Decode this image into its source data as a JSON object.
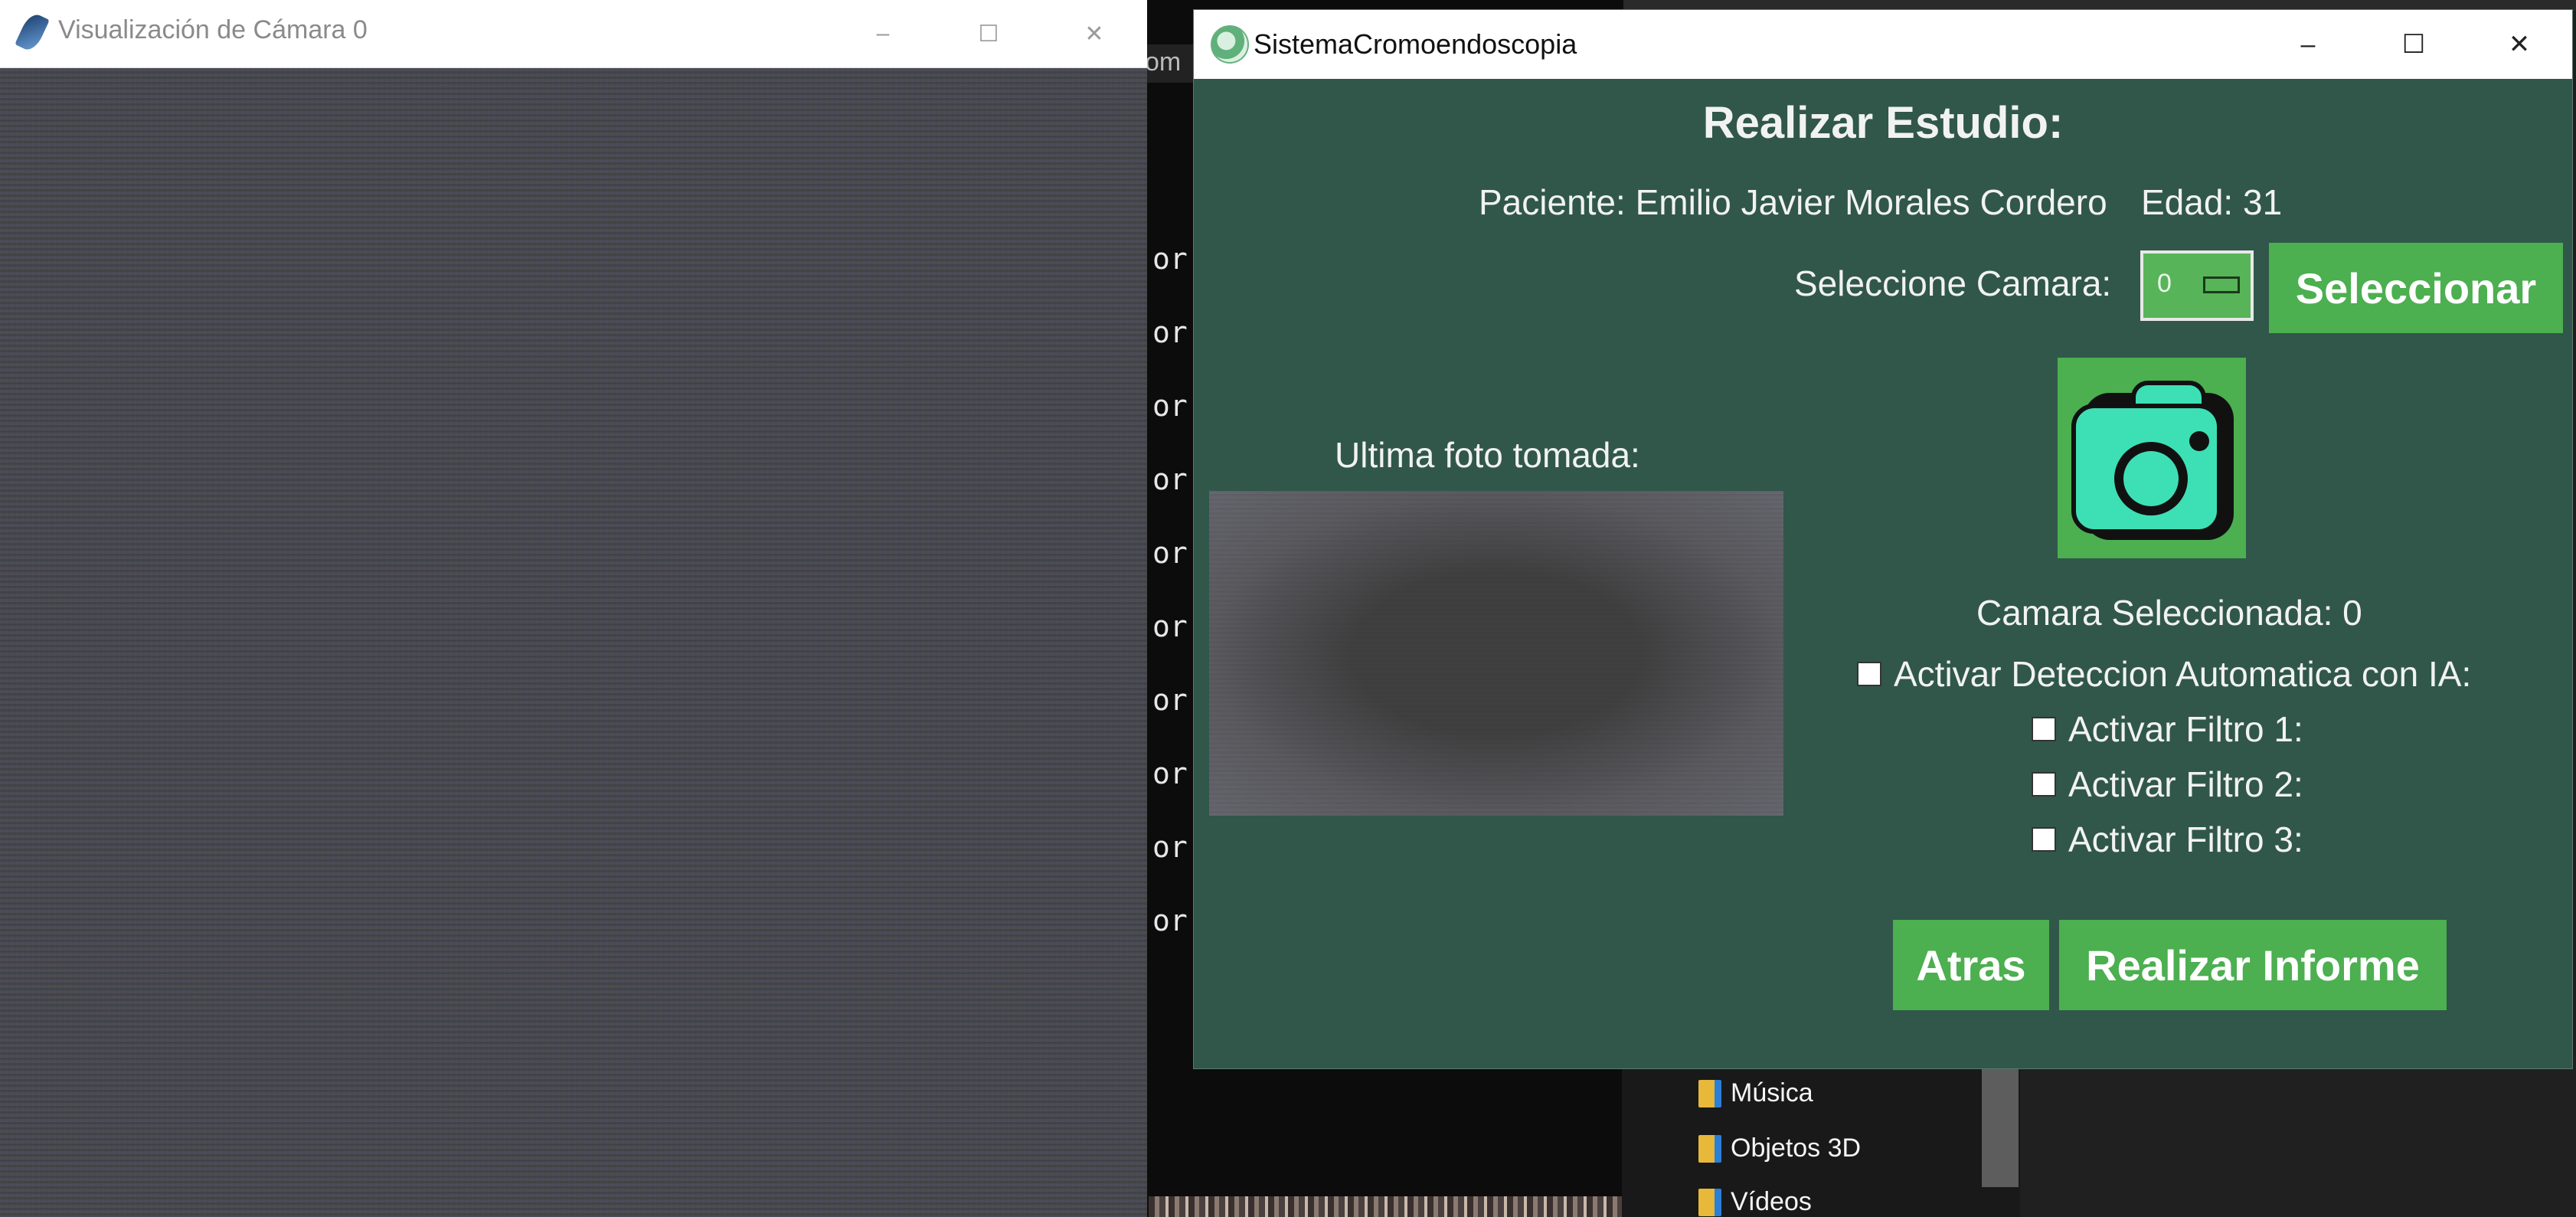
{
  "camera_window": {
    "title": "Visualización de Cámara 0",
    "controls": {
      "minimize": "–",
      "maximize": "☐",
      "close": "✕"
    }
  },
  "background": {
    "console_fragment": "om",
    "console_lines": [
      "or",
      "or",
      "or",
      "or",
      "or",
      "or",
      "or",
      "or",
      "or",
      "or"
    ],
    "explorer_items": [
      "Música",
      "Objetos 3D",
      "Vídeos"
    ]
  },
  "app": {
    "title": "SistemaCromoendoscopia",
    "controls": {
      "minimize": "–",
      "maximize": "☐",
      "close": "✕"
    },
    "heading": "Realizar Estudio:",
    "patient": "Paciente: Emilio Javier Morales Cordero",
    "age": "Edad: 31",
    "camera_select": {
      "label": "Seleccione Camara:",
      "value": "0",
      "button": "Seleccionar"
    },
    "last_photo_label": "Ultima foto tomada:",
    "camera_selected": "Camara Seleccionada: 0",
    "options": [
      {
        "label": "Activar Deteccion Automatica con IA:",
        "checked": false
      },
      {
        "label": "Activar Filtro 1:",
        "checked": false
      },
      {
        "label": "Activar Filtro 2:",
        "checked": false
      },
      {
        "label": "Activar Filtro 3:",
        "checked": false
      }
    ],
    "buttons": {
      "back": "Atras",
      "report": "Realizar Informe"
    },
    "colors": {
      "background": "#30574a",
      "button": "#4caf50",
      "camera_icon": "#3de0b4"
    }
  }
}
